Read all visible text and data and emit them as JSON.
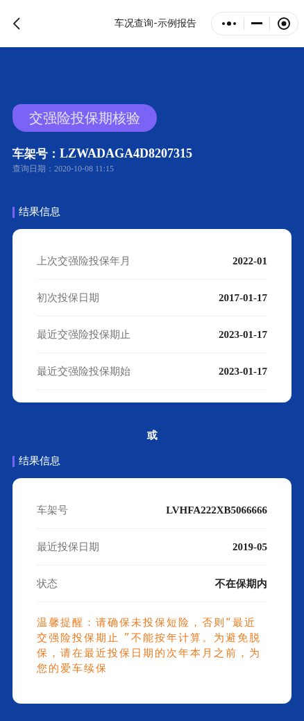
{
  "nav_bar": {
    "title": "车况查询-示例报告"
  },
  "report": {
    "badge": "交强险投保期核验",
    "vin_label": "车架号：",
    "vin": "LZWADAGA4D8207315",
    "date_label": "查询日期：",
    "date": "2020-10-08 11:15"
  },
  "sections": [
    {
      "title": "结果信息",
      "rows": [
        {
          "label": "上次交强险投保年月",
          "value": "2022-01"
        },
        {
          "label": "初次投保日期",
          "value": "2017-01-17"
        },
        {
          "label": "最近交强险投保期止",
          "value": "2023-01-17"
        },
        {
          "label": "最近交强险投保期始",
          "value": "2023-01-17"
        }
      ]
    },
    {
      "title": "结果信息",
      "rows": [
        {
          "label": "车架号",
          "value": "LVHFA222XB5066666"
        },
        {
          "label": "最近投保日期",
          "value": "2019-05"
        },
        {
          "label": "状态",
          "value": "不在保期内"
        }
      ],
      "notice": "温馨提醒：请确保未投保短险，否则“最近交强险投保期止 ”不能按年计算。为避免脱保，请在最近投保日期的次年本月之前，为您的爱车续保"
    }
  ],
  "separator": "或"
}
